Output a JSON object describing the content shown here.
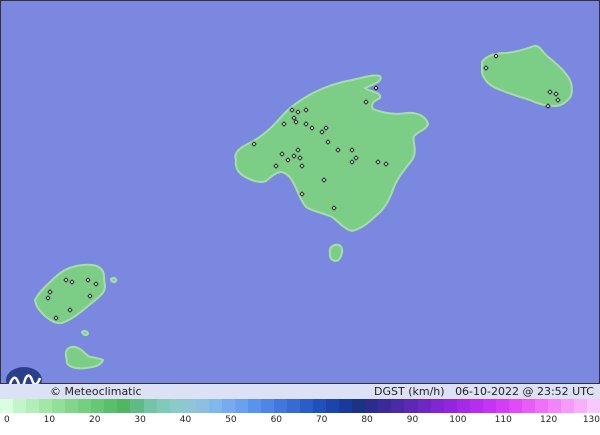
{
  "brand": {
    "name": "Meteoclimatic",
    "copyright": "©"
  },
  "map": {
    "sea_color": "#7b88e0",
    "land_color": "#7ccd85",
    "land_highlight": "#bfe7c2",
    "coast_color": "#a6dda9",
    "station_color": "#222222"
  },
  "footer": {
    "variable": "DGST (km/h)",
    "timestamp": "06-10-2022 @ 23:52 UTC"
  },
  "scale": {
    "ticks": [
      "0",
      "10",
      "20",
      "30",
      "40",
      "50",
      "60",
      "70",
      "80",
      "90",
      "100",
      "110",
      "120",
      "130"
    ],
    "colors": [
      "#d7ffe0",
      "#c2f5c9",
      "#b2eeb8",
      "#a3e7a7",
      "#94df97",
      "#82d68a",
      "#74cf7f",
      "#68c774",
      "#5bbe6a",
      "#51b562",
      "#5fba86",
      "#75c4a6",
      "#81c9b8",
      "#8cc9c9",
      "#8ec6d6",
      "#8cbfe2",
      "#82b7ec",
      "#77aaf0",
      "#6aa0f0",
      "#5a93ec",
      "#4d86e6",
      "#4078dd",
      "#356bd3",
      "#2a5dc9",
      "#2050bd",
      "#1b44ad",
      "#173a9d",
      "#1b3385",
      "#2a2d8e",
      "#3a2a9a",
      "#4b2aa8",
      "#5d28b6",
      "#6f27c4",
      "#8126d2",
      "#9325df",
      "#a52ae8",
      "#b52ef0",
      "#c533f5",
      "#d43df7",
      "#e04af8",
      "#e95cf9",
      "#ef70fa",
      "#f384fb",
      "#f69afc",
      "#f8b0fd",
      "#fac7fe"
    ]
  }
}
